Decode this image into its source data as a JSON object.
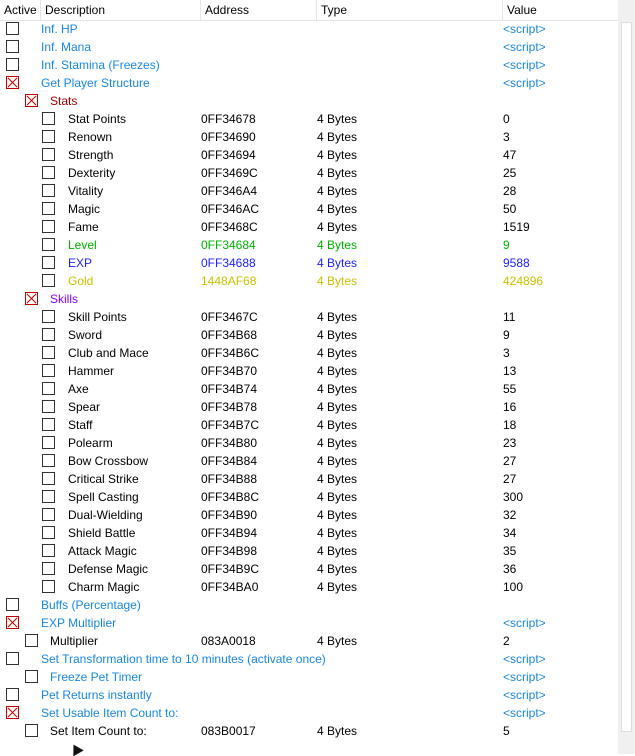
{
  "header": {
    "active": "Active",
    "description": "Description",
    "address": "Address",
    "type": "Type",
    "value": "Value"
  },
  "rows": [
    {
      "d": "Inf. HP",
      "a": "",
      "t": "",
      "v": "<script>",
      "checked": false,
      "indent": 0,
      "color": "blue"
    },
    {
      "d": "Inf. Mana",
      "a": "",
      "t": "",
      "v": "<script>",
      "checked": false,
      "indent": 0,
      "color": "blue"
    },
    {
      "d": "Inf. Stamina (Freezes)",
      "a": "",
      "t": "",
      "v": "<script>",
      "checked": false,
      "indent": 0,
      "color": "blue"
    },
    {
      "d": "Get Player Structure",
      "a": "",
      "t": "",
      "v": "<script>",
      "checked": true,
      "indent": 0,
      "color": "blue"
    },
    {
      "d": "Stats",
      "a": "",
      "t": "",
      "v": "",
      "checked": true,
      "indent": 1,
      "color": "darkred"
    },
    {
      "d": "Stat Points",
      "a": "0FF34678",
      "t": "4 Bytes",
      "v": "0",
      "checked": false,
      "indent": 2,
      "color": ""
    },
    {
      "d": "Renown",
      "a": "0FF34690",
      "t": "4 Bytes",
      "v": "3",
      "checked": false,
      "indent": 2,
      "color": ""
    },
    {
      "d": "Strength",
      "a": "0FF34694",
      "t": "4 Bytes",
      "v": "47",
      "checked": false,
      "indent": 2,
      "color": ""
    },
    {
      "d": "Dexterity",
      "a": "0FF3469C",
      "t": "4 Bytes",
      "v": "25",
      "checked": false,
      "indent": 2,
      "color": ""
    },
    {
      "d": "Vitality",
      "a": "0FF346A4",
      "t": "4 Bytes",
      "v": "28",
      "checked": false,
      "indent": 2,
      "color": ""
    },
    {
      "d": "Magic",
      "a": "0FF346AC",
      "t": "4 Bytes",
      "v": "50",
      "checked": false,
      "indent": 2,
      "color": ""
    },
    {
      "d": "Fame",
      "a": "0FF3468C",
      "t": "4 Bytes",
      "v": "1519",
      "checked": false,
      "indent": 2,
      "color": ""
    },
    {
      "d": "Level",
      "a": "0FF34684",
      "t": "4 Bytes",
      "v": "9",
      "checked": false,
      "indent": 2,
      "color": "green"
    },
    {
      "d": "EXP",
      "a": "0FF34688",
      "t": "4 Bytes",
      "v": "9588",
      "checked": false,
      "indent": 2,
      "color": "expblue"
    },
    {
      "d": "Gold",
      "a": "1448AF68",
      "t": "4 Bytes",
      "v": "424896",
      "checked": false,
      "indent": 2,
      "color": "gold"
    },
    {
      "d": "Skills",
      "a": "",
      "t": "",
      "v": "",
      "checked": true,
      "indent": 1,
      "color": "purple"
    },
    {
      "d": "Skill Points",
      "a": "0FF3467C",
      "t": "4 Bytes",
      "v": "11",
      "checked": false,
      "indent": 2,
      "color": ""
    },
    {
      "d": "Sword",
      "a": "0FF34B68",
      "t": "4 Bytes",
      "v": "9",
      "checked": false,
      "indent": 2,
      "color": ""
    },
    {
      "d": "Club and Mace",
      "a": "0FF34B6C",
      "t": "4 Bytes",
      "v": "3",
      "checked": false,
      "indent": 2,
      "color": ""
    },
    {
      "d": "Hammer",
      "a": "0FF34B70",
      "t": "4 Bytes",
      "v": "13",
      "checked": false,
      "indent": 2,
      "color": ""
    },
    {
      "d": "Axe",
      "a": "0FF34B74",
      "t": "4 Bytes",
      "v": "55",
      "checked": false,
      "indent": 2,
      "color": ""
    },
    {
      "d": "Spear",
      "a": "0FF34B78",
      "t": "4 Bytes",
      "v": "16",
      "checked": false,
      "indent": 2,
      "color": ""
    },
    {
      "d": "Staff",
      "a": "0FF34B7C",
      "t": "4 Bytes",
      "v": "18",
      "checked": false,
      "indent": 2,
      "color": ""
    },
    {
      "d": "Polearm",
      "a": "0FF34B80",
      "t": "4 Bytes",
      "v": "23",
      "checked": false,
      "indent": 2,
      "color": ""
    },
    {
      "d": "Bow Crossbow",
      "a": "0FF34B84",
      "t": "4 Bytes",
      "v": "27",
      "checked": false,
      "indent": 2,
      "color": ""
    },
    {
      "d": "Critical Strike",
      "a": "0FF34B88",
      "t": "4 Bytes",
      "v": "27",
      "checked": false,
      "indent": 2,
      "color": ""
    },
    {
      "d": "Spell Casting",
      "a": "0FF34B8C",
      "t": "4 Bytes",
      "v": "300",
      "checked": false,
      "indent": 2,
      "color": ""
    },
    {
      "d": "Dual-Wielding",
      "a": "0FF34B90",
      "t": "4 Bytes",
      "v": "32",
      "checked": false,
      "indent": 2,
      "color": ""
    },
    {
      "d": "Shield Battle",
      "a": "0FF34B94",
      "t": "4 Bytes",
      "v": "34",
      "checked": false,
      "indent": 2,
      "color": ""
    },
    {
      "d": "Attack Magic",
      "a": "0FF34B98",
      "t": "4 Bytes",
      "v": "35",
      "checked": false,
      "indent": 2,
      "color": ""
    },
    {
      "d": "Defense Magic",
      "a": "0FF34B9C",
      "t": "4 Bytes",
      "v": "36",
      "checked": false,
      "indent": 2,
      "color": ""
    },
    {
      "d": "Charm Magic",
      "a": "0FF34BA0",
      "t": "4 Bytes",
      "v": "100",
      "checked": false,
      "indent": 2,
      "color": ""
    },
    {
      "d": "Buffs (Percentage)",
      "a": "",
      "t": "",
      "v": "",
      "checked": false,
      "indent": 0,
      "color": "blue"
    },
    {
      "d": "EXP Multiplier",
      "a": "",
      "t": "",
      "v": "<script>",
      "checked": true,
      "indent": 0,
      "color": "blue"
    },
    {
      "d": "Multiplier",
      "a": "083A0018",
      "t": "4 Bytes",
      "v": "2",
      "checked": false,
      "indent": 1,
      "color": ""
    },
    {
      "d": "Set Transformation time to 10 minutes (activate once)",
      "a": "",
      "t": "",
      "v": "<script>",
      "checked": false,
      "indent": 0,
      "color": "blue"
    },
    {
      "d": "Freeze Pet Timer",
      "a": "",
      "t": "",
      "v": "<script>",
      "checked": false,
      "indent": 1,
      "color": "blue"
    },
    {
      "d": "Pet Returns instantly",
      "a": "",
      "t": "",
      "v": "<script>",
      "checked": false,
      "indent": 0,
      "color": "blue"
    },
    {
      "d": "Set Usable Item Count to:",
      "a": "",
      "t": "",
      "v": "<script>",
      "checked": true,
      "indent": 0,
      "color": "blue"
    },
    {
      "d": "Set Item Count to:",
      "a": "083B0017",
      "t": "4 Bytes",
      "v": "5",
      "checked": false,
      "indent": 1,
      "color": ""
    }
  ]
}
